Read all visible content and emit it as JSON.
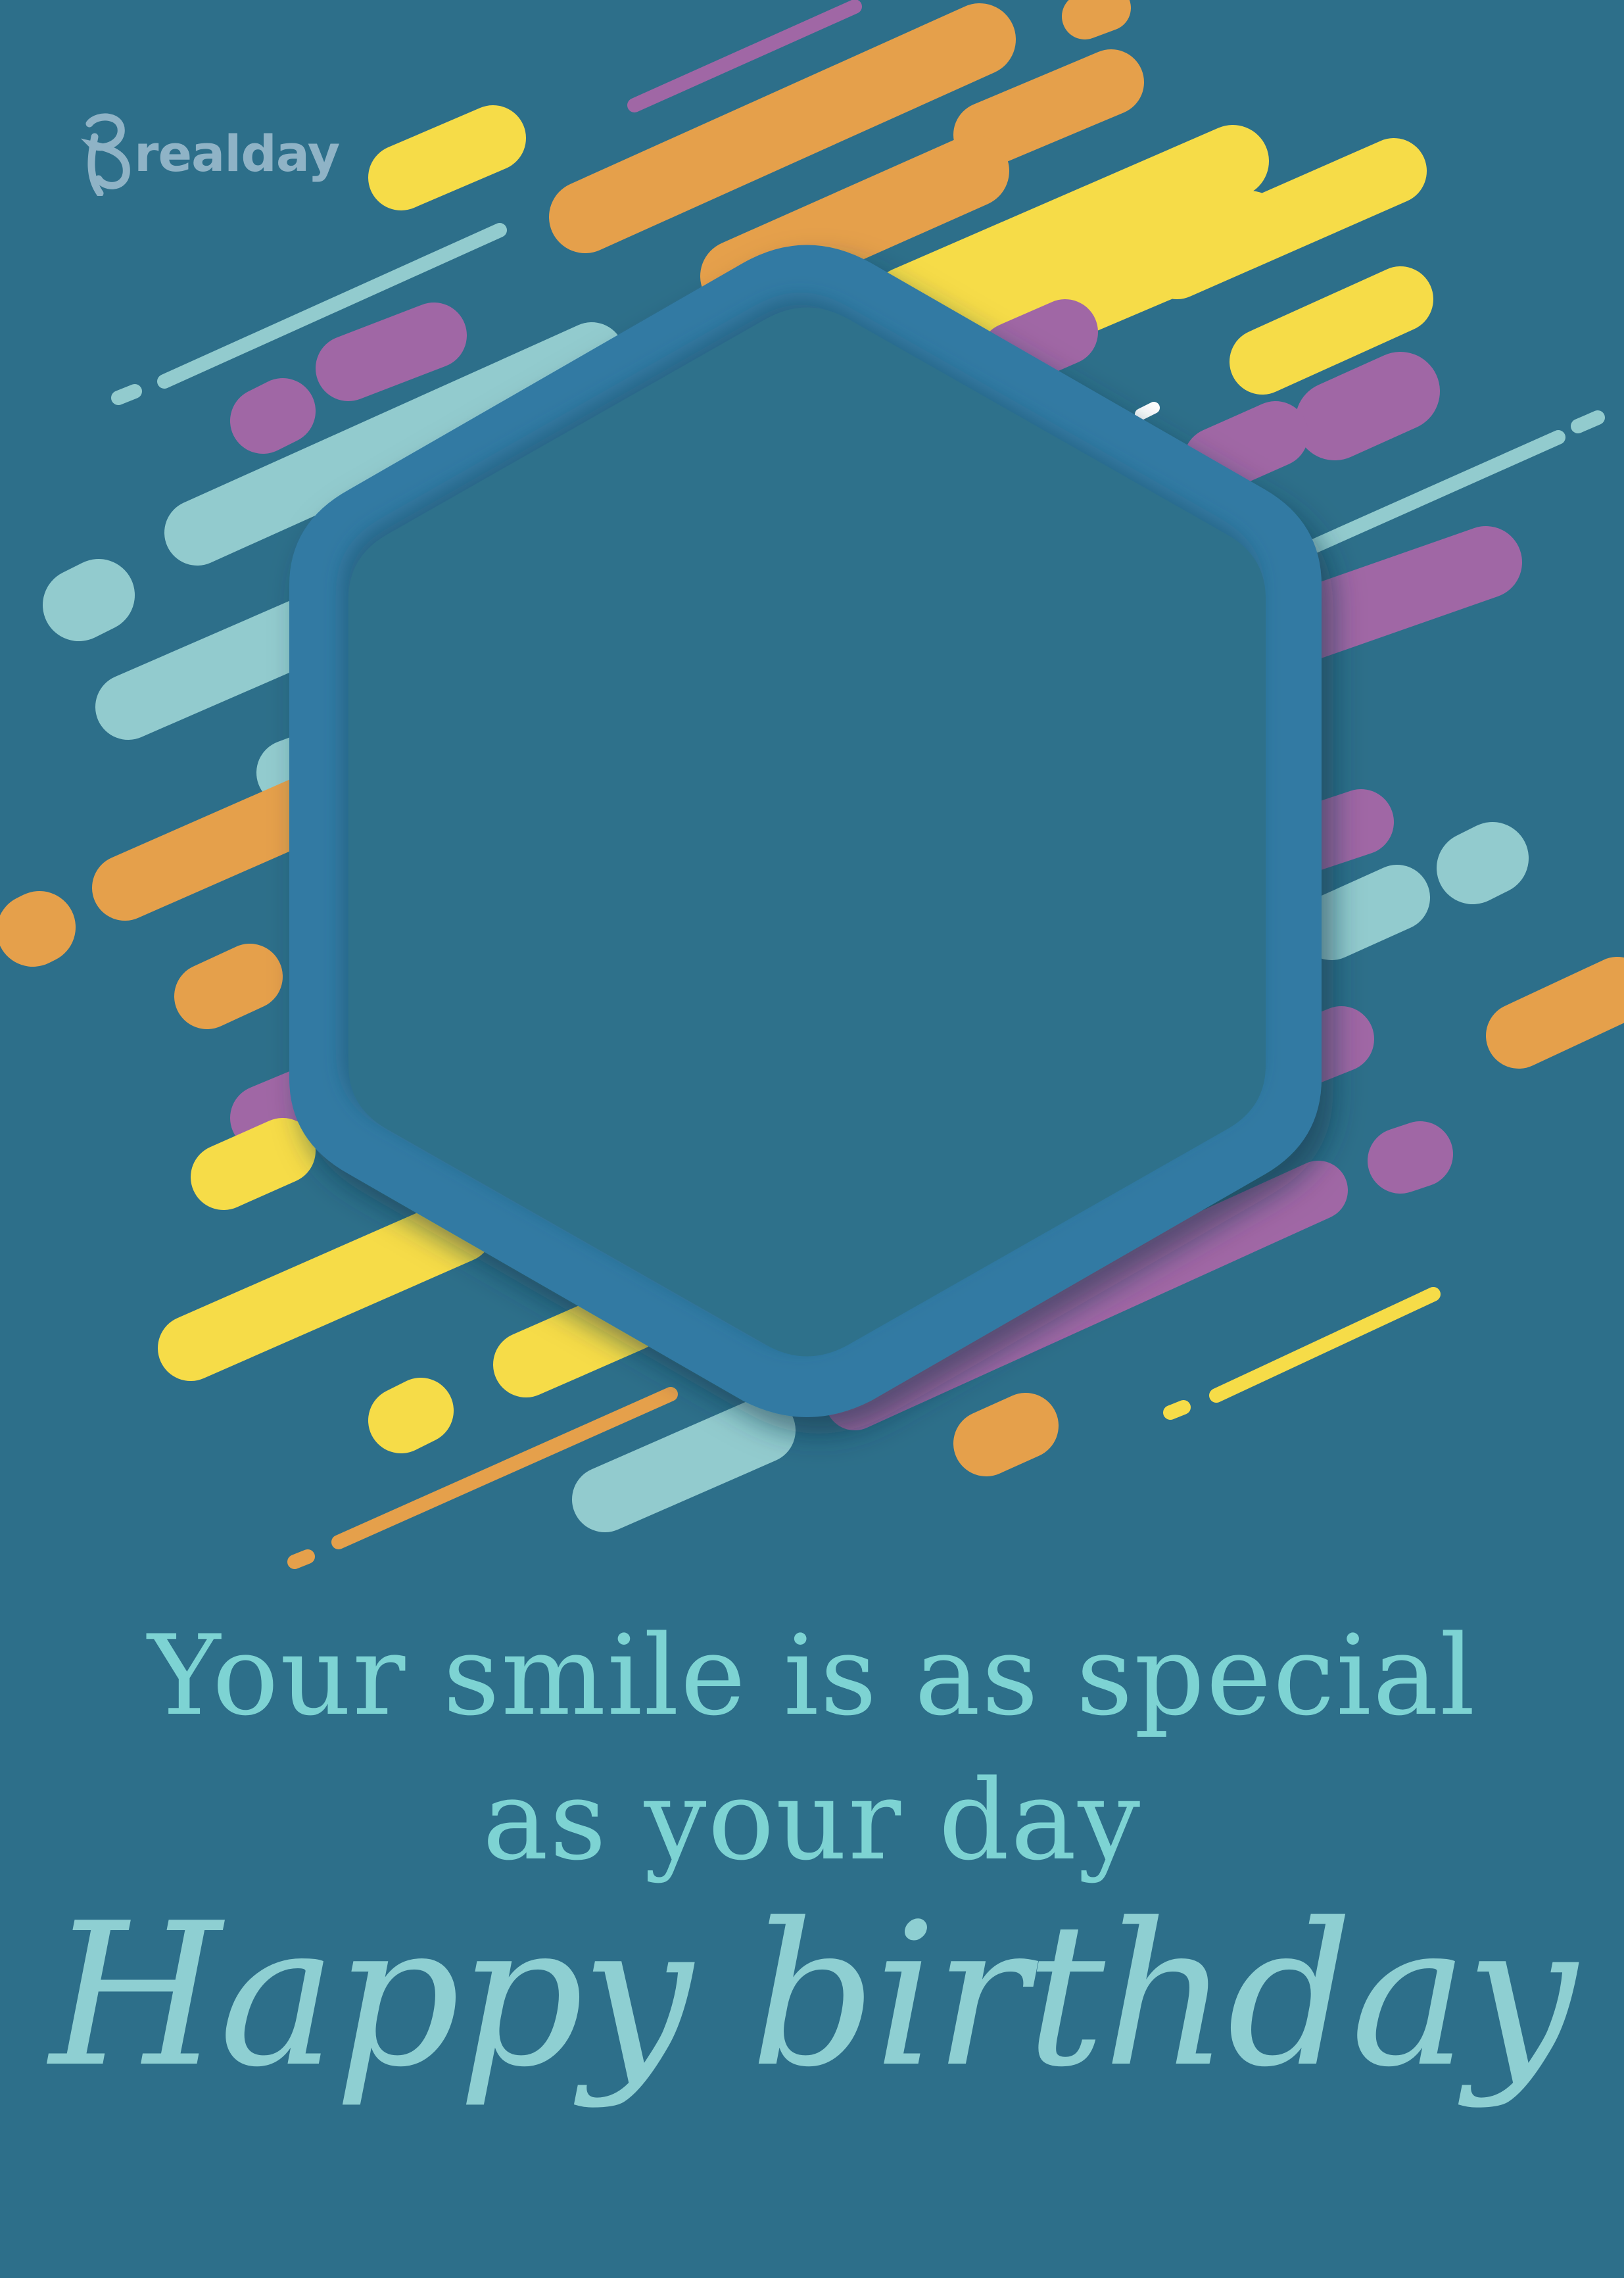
{
  "brand": {
    "name": "realday"
  },
  "message": {
    "line1": "Your smile is as special",
    "line2": "as your day"
  },
  "greeting": "Happy birthday",
  "colors": {
    "background": "#2D6F8A",
    "frame_outer": "#327AA3",
    "frame_inner": "#2E718B",
    "orange": "#E5A04B",
    "yellow": "#F6DC48",
    "purple": "#A067A5",
    "aqua": "#92CBCE",
    "message_text": "#7DD3D3",
    "greeting_text": "#8ECFD2",
    "logo": "#8FB3C6"
  },
  "icons": {
    "logo_mark": "realday-r-logo-icon"
  }
}
